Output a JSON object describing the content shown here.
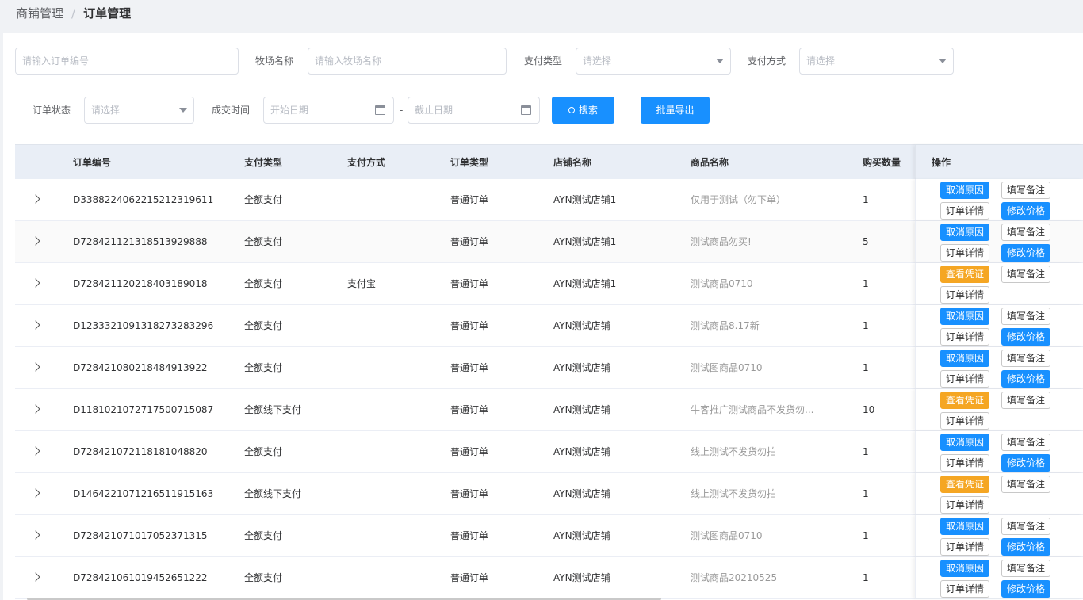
{
  "breadcrumb": {
    "parent": "商铺管理",
    "separator": "/",
    "current": "订单管理"
  },
  "filters": {
    "order_no_placeholder": "请输入订单编号",
    "farm_label": "牧场名称",
    "farm_placeholder": "请输入牧场名称",
    "pay_type_label": "支付类型",
    "pay_type_placeholder": "请选择",
    "pay_method_label": "支付方式",
    "pay_method_placeholder": "请选择",
    "status_label": "订单状态",
    "status_placeholder": "请选择",
    "time_label": "成交时间",
    "start_placeholder": "开始日期",
    "range_sep": "-",
    "end_placeholder": "截止日期",
    "search_label": "搜索",
    "export_label": "批量导出"
  },
  "table": {
    "headers": [
      "订单编号",
      "支付类型",
      "支付方式",
      "订单类型",
      "店铺名称",
      "商品名称",
      "购买数量",
      "操作"
    ],
    "rows": [
      {
        "order_no": "D3388224062215212319611",
        "pay_type": "全额支付",
        "pay_method": "",
        "order_type": "普通订单",
        "shop": "AYN测试店铺1",
        "product": "仅用于测试（勿下单）",
        "qty": "1",
        "actions": [
          "取消原因",
          "填写备注",
          "订单详情",
          "修改价格"
        ]
      },
      {
        "order_no": "D7284211213185139298​88",
        "pay_type": "全额支付",
        "pay_method": "",
        "order_type": "普通订单",
        "shop": "AYN测试店铺1",
        "product": "测试商品勿买!",
        "qty": "5",
        "actions": [
          "取消原因",
          "填写备注",
          "订单详情",
          "修改价格"
        ]
      },
      {
        "order_no": "D728421120218403189018",
        "pay_type": "全额支付",
        "pay_method": "支付宝",
        "order_type": "普通订单",
        "shop": "AYN测试店铺1",
        "product": "测试商品0710",
        "qty": "1",
        "actions": [
          "查看凭证",
          "填写备注",
          "订单详情"
        ]
      },
      {
        "order_no": "D123332109131827328329​6",
        "pay_type": "全额支付",
        "pay_method": "",
        "order_type": "普通订单",
        "shop": "AYN测试店铺",
        "product": "测试商品8.17新",
        "qty": "1",
        "actions": [
          "取消原因",
          "填写备注",
          "订单详情",
          "修改价格"
        ]
      },
      {
        "order_no": "D728421080218484913922",
        "pay_type": "全额支付",
        "pay_method": "",
        "order_type": "普通订单",
        "shop": "AYN测试店铺",
        "product": "测试图商品0710",
        "qty": "1",
        "actions": [
          "取消原因",
          "填写备注",
          "订单详情",
          "修改价格"
        ]
      },
      {
        "order_no": "D1181021072717500715087",
        "pay_type": "全额线下支付",
        "pay_method": "",
        "order_type": "普通订单",
        "shop": "AYN测试店铺",
        "product": "牛客推广测试商品不发货勿...",
        "qty": "10",
        "actions": [
          "查看凭证",
          "填写备注",
          "订单详情"
        ]
      },
      {
        "order_no": "D728421072118181048820",
        "pay_type": "全额支付",
        "pay_method": "",
        "order_type": "普通订单",
        "shop": "AYN测试店铺",
        "product": "线上测试不发货勿拍",
        "qty": "1",
        "actions": [
          "取消原因",
          "填写备注",
          "订单详情",
          "修改价格"
        ]
      },
      {
        "order_no": "D146422107121651191516​3",
        "pay_type": "全额线下支付",
        "pay_method": "",
        "order_type": "普通订单",
        "shop": "AYN测试店铺",
        "product": "线上测试不发货勿拍",
        "qty": "1",
        "actions": [
          "查看凭证",
          "填写备注",
          "订单详情"
        ]
      },
      {
        "order_no": "D728421071017052371315",
        "pay_type": "全额支付",
        "pay_method": "",
        "order_type": "普通订单",
        "shop": "AYN测试店铺",
        "product": "测试图商品0710",
        "qty": "1",
        "actions": [
          "取消原因",
          "填写备注",
          "订单详情",
          "修改价格"
        ]
      },
      {
        "order_no": "D728421061019452651222",
        "pay_type": "全额支付",
        "pay_method": "",
        "order_type": "普通订单",
        "shop": "AYN测试店铺",
        "product": "测试商品20210525",
        "qty": "1",
        "actions": [
          "取消原因",
          "填写备注",
          "订单详情",
          "修改价格"
        ]
      }
    ]
  },
  "colors": {
    "primary": "#1890ff",
    "warning": "#f5a623",
    "header_bg": "#e9eef6"
  }
}
